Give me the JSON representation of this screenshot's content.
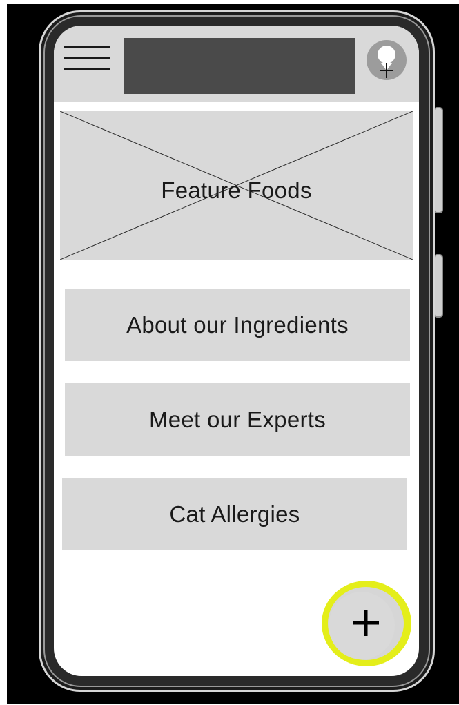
{
  "hero": {
    "title": "Feature Foods"
  },
  "menu": {
    "items": [
      {
        "label": "About our Ingredients"
      },
      {
        "label": "Meet our Experts"
      },
      {
        "label": "Cat Allergies"
      }
    ]
  },
  "fab": {
    "symbol": "+",
    "highlight_color": "#e8f000"
  },
  "colors": {
    "header_bg": "#d9d9d9",
    "title_block": "#4a4a4a",
    "card_bg": "#d9d9d9"
  }
}
